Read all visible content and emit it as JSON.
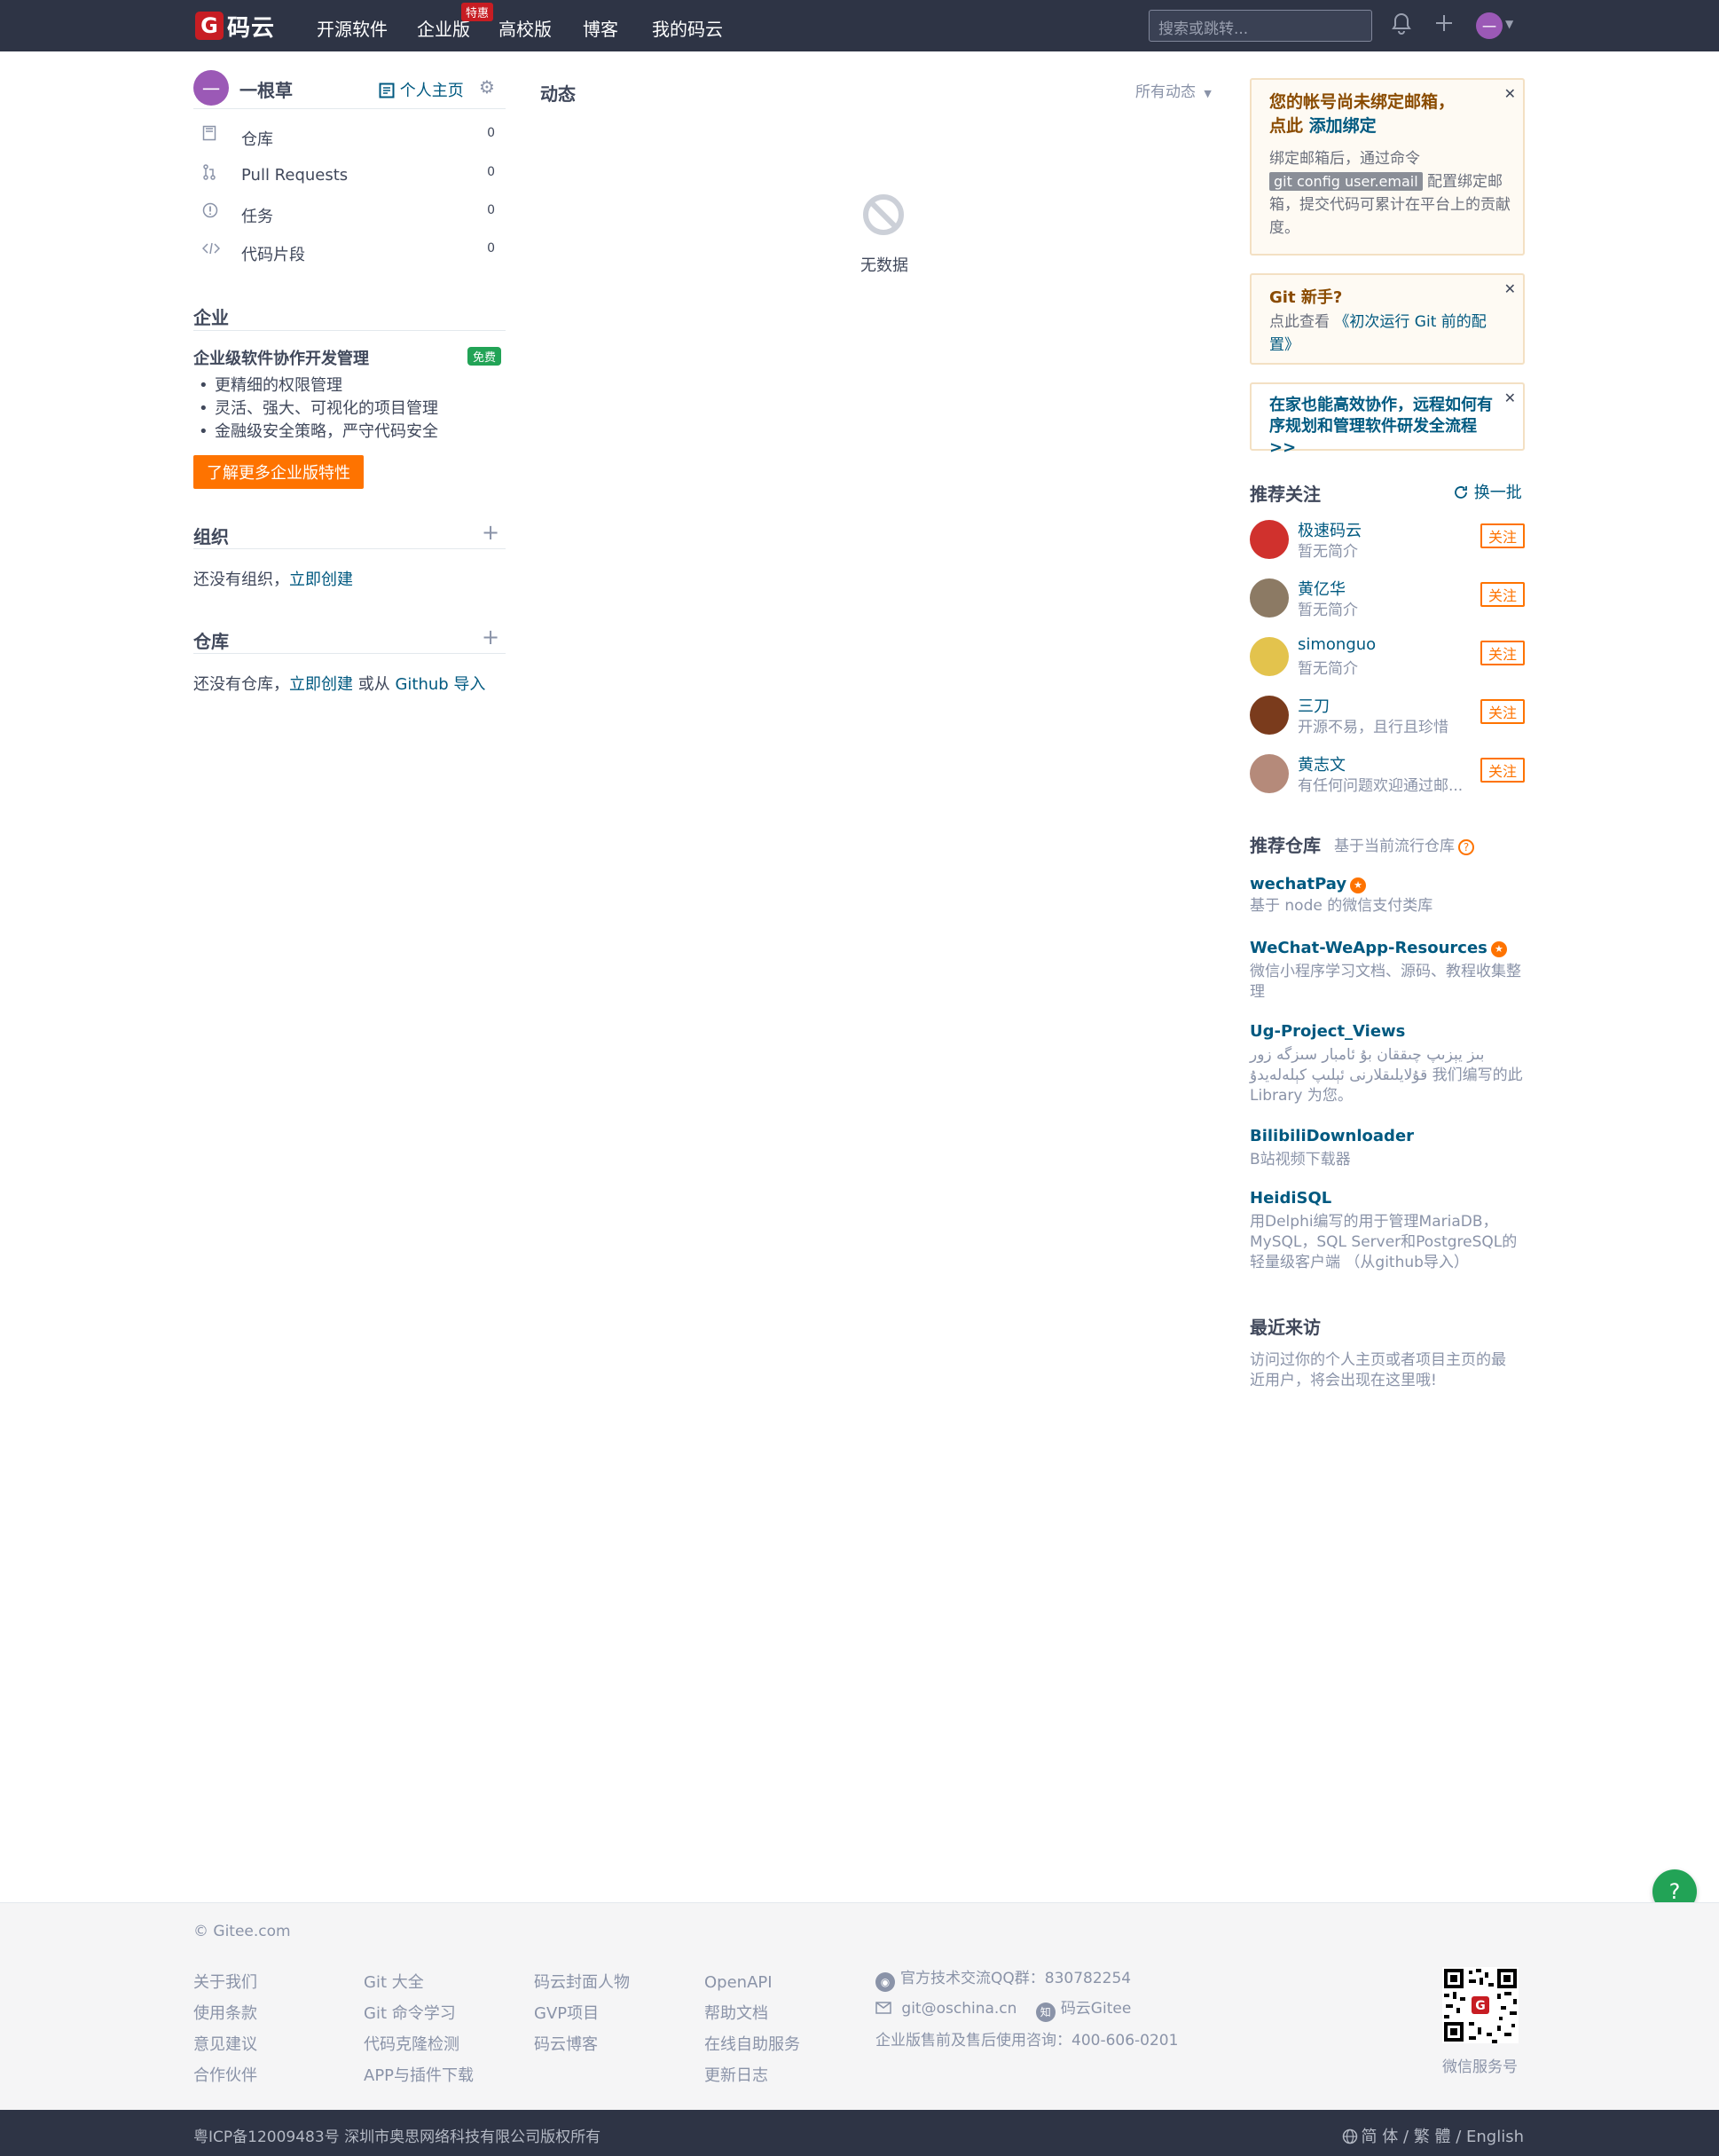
{
  "header": {
    "logo_mark": "G",
    "logo_text": "码云",
    "nav": [
      "开源软件",
      "企业版",
      "高校版",
      "博客",
      "我的码云"
    ],
    "enterprise_badge": "特惠",
    "search_placeholder": "搜索或跳转...",
    "user_avatar_text": "一"
  },
  "sidebar": {
    "avatar_text": "一",
    "username": "一根草",
    "homepage_link": "个人主页",
    "menu": [
      {
        "label": "仓库",
        "count": "0",
        "icon": "repo-icon"
      },
      {
        "label": "Pull Requests",
        "count": "0",
        "icon": "pull-request-icon"
      },
      {
        "label": "任务",
        "count": "0",
        "icon": "issue-icon"
      },
      {
        "label": "代码片段",
        "count": "0",
        "icon": "code-icon"
      }
    ],
    "enterprise": {
      "title": "企业",
      "heading": "企业级软件协作开发管理",
      "badge": "免费",
      "bullets": [
        "更精细的权限管理",
        "灵活、强大、可视化的项目管理",
        "金融级安全策略，严守代码安全"
      ],
      "button": "了解更多企业版特性"
    },
    "org": {
      "title": "组织",
      "text": "还没有组织，",
      "link": "立即创建"
    },
    "repos": {
      "title": "仓库",
      "text1": "还没有仓库，",
      "link1": "立即创建",
      "text2": " 或从 ",
      "link2": "Github 导入"
    }
  },
  "feed": {
    "title": "动态",
    "filter": "所有动态",
    "empty": "无数据"
  },
  "notices": {
    "email": {
      "title_1": "您的帐号尚未绑定邮箱，",
      "title_2": "点此 ",
      "title_link": "添加绑定",
      "body_1": "绑定邮箱后，通过命令",
      "code": "git config user.email",
      "body_2": " 配置绑定邮箱，提交代码可累计在平台上的贡献度。"
    },
    "git": {
      "title": "Git 新手?",
      "body_1": "点此查看 ",
      "body_link": "《初次运行 Git 前的配置》"
    },
    "remote": {
      "title": "在家也能高效协作，远程如何有序规划和管理软件研发全流程 >>"
    }
  },
  "recommend_users": {
    "title": "推荐关注",
    "refresh": "换一批",
    "follow": "关注",
    "users": [
      {
        "name": "极速码云",
        "desc": "暂无简介",
        "color": "#d0312d"
      },
      {
        "name": "黄亿华",
        "desc": "暂无简介",
        "color": "#8c7a64"
      },
      {
        "name": "simonguo",
        "desc": "暂无简介",
        "color": "#e3c34d"
      },
      {
        "name": "三刀",
        "desc": "开源不易，且行且珍惜",
        "color": "#7a3b1c"
      },
      {
        "name": "黄志文",
        "desc": "有任何问题欢迎通过邮...",
        "color": "#b58a7a"
      }
    ]
  },
  "recommend_repos": {
    "title": "推荐仓库",
    "subtitle": "基于当前流行仓库",
    "repos": [
      {
        "name": "wechatPay",
        "desc": "基于 node 的微信支付类库",
        "gvp": true
      },
      {
        "name": "WeChat-WeApp-Resources",
        "desc": "微信小程序学习文档、源码、教程收集整理",
        "gvp": true
      },
      {
        "name": "Ug-Project_Views",
        "desc": "بىز يېزىپ چىققان بۇ ئامبار سىزگە زور قۇلايلىقلارنى ئېلىپ كېلەلەيدۇ 我们编写的此Library 为您。",
        "gvp": false
      },
      {
        "name": "BilibiliDownloader",
        "desc": "B站视频下载器",
        "gvp": false
      },
      {
        "name": "HeidiSQL",
        "desc": "用Delphi编写的用于管理MariaDB，MySQL，SQL Server和PostgreSQL的轻量级客户端 （从github导入）",
        "gvp": false
      }
    ]
  },
  "recent_visitors": {
    "title": "最近来访",
    "text": "访问过你的个人主页或者项目主页的最近用户，将会出现在这里哦!"
  },
  "footer": {
    "copyright": "© Gitee.com",
    "col1": [
      "关于我们",
      "使用条款",
      "意见建议",
      "合作伙伴"
    ],
    "col2": [
      "Git 大全",
      "Git 命令学习",
      "代码克隆检测",
      "APP与插件下载"
    ],
    "col3": [
      "码云封面人物",
      "GVP项目",
      "码云博客"
    ],
    "col4": [
      "OpenAPI",
      "帮助文档",
      "在线自助服务",
      "更新日志"
    ],
    "qq": "官方技术交流QQ群：830782254",
    "email": "git@oschina.cn",
    "zhihu": "码云Gitee",
    "zhihu_icon": "知",
    "consult": "企业版售前及售后使用咨询：400-606-0201",
    "qr_label": "微信服务号",
    "icp": "粤ICP备12009483号 深圳市奥思网络科技有限公司版权所有",
    "lang": "简 体 / 繁 體 / English"
  }
}
